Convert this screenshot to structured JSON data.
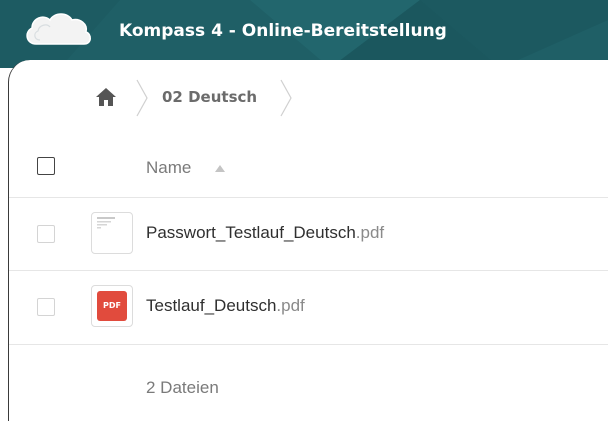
{
  "header": {
    "title": "Kompass 4 - Online-Bereitstellung",
    "logo": "cloud-logo",
    "background_color": "#1f5f66"
  },
  "breadcrumb": {
    "home_icon": "home-icon",
    "items": [
      {
        "label": "02 Deutsch"
      }
    ]
  },
  "file_list": {
    "header": {
      "name_label": "Name",
      "sort_icon": "sort-ascending-icon"
    },
    "files": [
      {
        "name": "Passwort_Testlauf_Deutsch",
        "extension": ".pdf",
        "thumbnail": "document-preview"
      },
      {
        "name": "Testlauf_Deutsch",
        "extension": ".pdf",
        "thumbnail": "pdf-icon",
        "badge_text": "PDF",
        "badge_color": "#e14b3d"
      }
    ],
    "summary": "2 Dateien"
  }
}
